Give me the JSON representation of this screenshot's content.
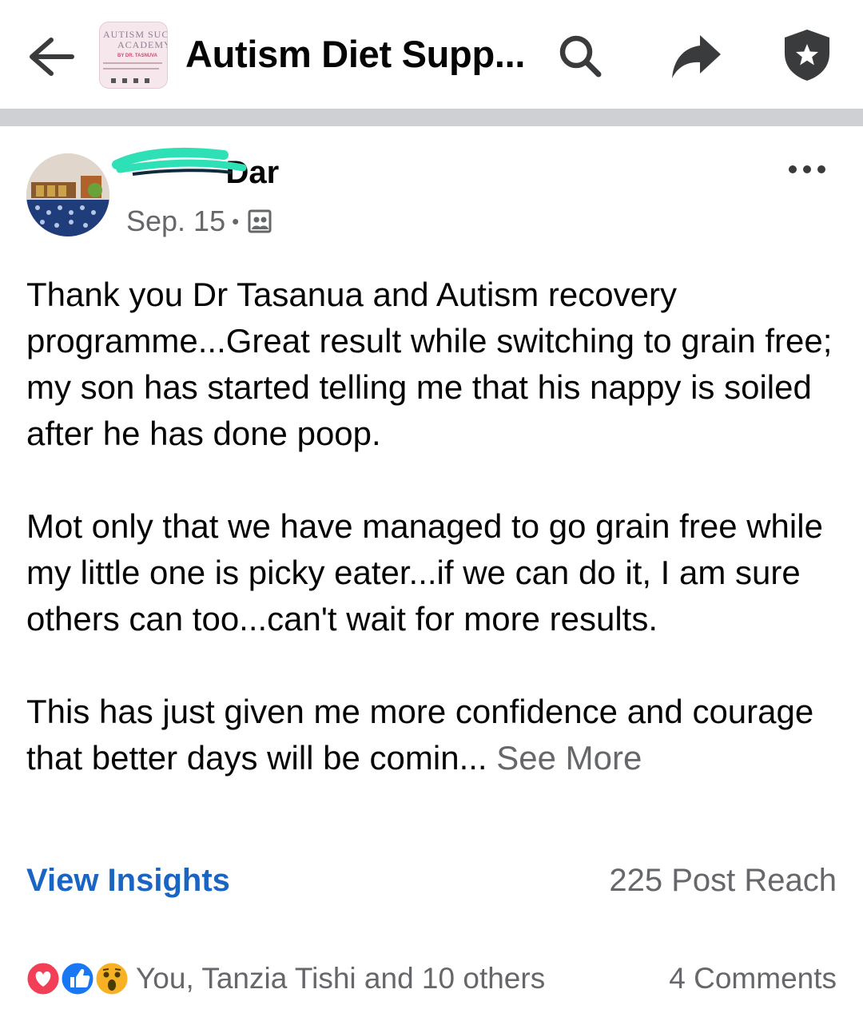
{
  "header": {
    "group_title": "Autism Diet Supp...",
    "thumb_line1": "AUTISM SUC",
    "thumb_line2": "ACADEMY",
    "thumb_line3": "BY DR. TASNUVA",
    "icons": [
      "back-arrow-icon",
      "search-icon",
      "share-icon",
      "admin-badge-icon"
    ]
  },
  "post": {
    "author_suffix": "Dar",
    "date": "Sep. 15",
    "separator": "•",
    "paragraphs": [
      "Thank you Dr Tasanua and Autism recovery programme...Great result while switching to grain free; my son has started telling me that his nappy is soiled after he has done poop.",
      "Mot only that we have managed to go grain free while my little one is picky eater...if we can do it, I am sure others can too...can't wait for more results.",
      "This has just given me more confidence and courage that better days will be comin..."
    ],
    "see_more": "See More"
  },
  "insights": {
    "link_label": "View Insights",
    "reach": "225 Post Reach"
  },
  "engagement": {
    "reactions_text": "You, Tanzia Tishi and 10 others",
    "comments": "4 Comments",
    "reaction_icons": [
      "love-reaction-icon",
      "like-reaction-icon",
      "wow-reaction-icon"
    ]
  },
  "colors": {
    "link_blue": "#1a64c2",
    "secondary_text": "#65676b",
    "divider": "#ced0d4",
    "scribble": "#2ee0b6"
  }
}
